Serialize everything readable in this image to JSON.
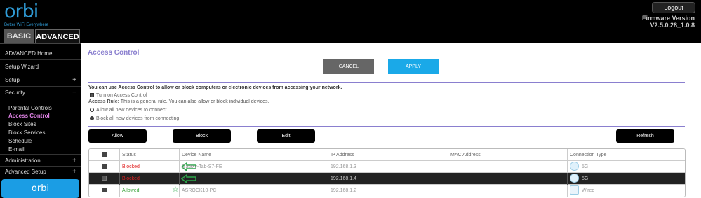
{
  "header": {
    "logo_word": "orbi",
    "logo_tagline": "Better WiFi Everywhere",
    "logout": "Logout",
    "fw_label": "Firmware Version",
    "fw_value": "V2.5.0.28_1.0.8",
    "tabs": [
      {
        "label": "BASIC"
      },
      {
        "label": "ADVANCED"
      }
    ]
  },
  "sidebar": {
    "items": [
      {
        "label": "ADVANCED Home",
        "sign": ""
      },
      {
        "label": "Setup Wizard",
        "sign": ""
      },
      {
        "label": "Setup",
        "sign": "+"
      },
      {
        "label": "Security",
        "sign": "−"
      }
    ],
    "security_sub": [
      {
        "label": "Parental Controls"
      },
      {
        "label": "Access Control"
      },
      {
        "label": "Block Sites"
      },
      {
        "label": "Block Services"
      },
      {
        "label": "Schedule"
      },
      {
        "label": "E-mail"
      }
    ],
    "more_items": [
      {
        "label": "Administration",
        "sign": "+"
      },
      {
        "label": "Advanced Setup",
        "sign": "+"
      }
    ],
    "promo": "orbi"
  },
  "main": {
    "title": "Access Control",
    "cancel": "CANCEL",
    "apply": "APPLY",
    "description": "You can use Access Control to allow or block computers or electronic devices from accessing your network.",
    "turn_on": "Turn on Access Control",
    "rule_label": "Access Rule:",
    "rule_text": " This is a general rule. You can also allow or block individual devices.",
    "option_allow": "Allow all new devices to connect",
    "option_block": "Block all new devices from connecting",
    "actions": {
      "allow": "Allow",
      "block": "Block",
      "edit": "Edit",
      "refresh": "Refresh"
    },
    "table": {
      "headers": {
        "status": "Status",
        "device": "Device Name",
        "ip": "IP Address",
        "mac": "MAC Address",
        "conn": "Connection Type"
      },
      "rows": [
        {
          "status": "Blocked",
          "device": "Galaxy-Tab-S7-FE",
          "ip": "192.168.1.3",
          "mac": "",
          "conn": "5G",
          "icon": "wifi-5g-icon"
        },
        {
          "status": "Blocked",
          "device": "--",
          "ip": "192.168.1.4",
          "mac": "",
          "conn": "5G",
          "icon": "wifi-5g-icon"
        },
        {
          "status": "Allowed",
          "device": "ASROCK10-PC",
          "ip": "192.168.1.2",
          "mac": "",
          "conn": "Wired",
          "icon": "wired-plug-icon"
        }
      ]
    }
  },
  "colors": {
    "accent": "#1aa9e8",
    "title": "#8a7fcf",
    "blocked": "#e02020",
    "allowed": "#3aa33a",
    "annotation": "#2ca84a"
  }
}
